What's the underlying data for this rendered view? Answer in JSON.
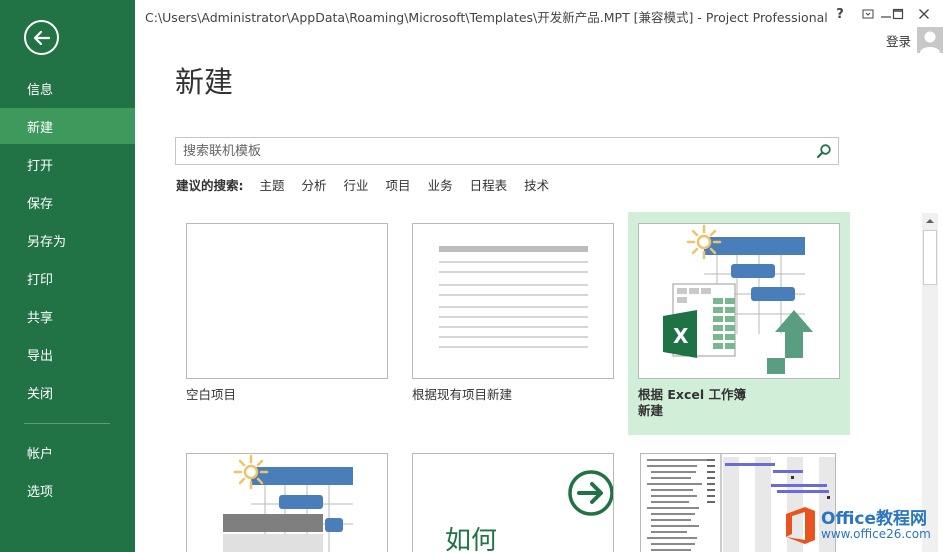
{
  "window": {
    "title": "C:\\Users\\Administrator\\AppData\\Roaming\\Microsoft\\Templates\\开发新产品.MPT [兼容模式] - Project Professional",
    "help": "?",
    "login": "登录"
  },
  "sidebar": {
    "items": [
      {
        "label": "信息"
      },
      {
        "label": "新建"
      },
      {
        "label": "打开"
      },
      {
        "label": "保存"
      },
      {
        "label": "另存为"
      },
      {
        "label": "打印"
      },
      {
        "label": "共享"
      },
      {
        "label": "导出"
      },
      {
        "label": "关闭"
      },
      {
        "label": "帐户"
      },
      {
        "label": "选项"
      }
    ],
    "active": "新建"
  },
  "main": {
    "title": "新建",
    "search": {
      "placeholder": "搜索联机模板",
      "value": ""
    },
    "suggestions": {
      "label": "建议的搜索:",
      "links": [
        "主题",
        "分析",
        "行业",
        "项目",
        "业务",
        "日程表",
        "技术"
      ]
    },
    "templates": [
      {
        "label": "空白项目"
      },
      {
        "label": "根据现有项目新建"
      },
      {
        "label_line1": "根据 Excel 工作簿",
        "label_line2": "新建"
      },
      {
        "label": ""
      },
      {
        "label": "",
        "thumb_text": "如何"
      },
      {
        "label": ""
      }
    ]
  },
  "watermark": {
    "line1": "Office教程网",
    "line2": "www.office26.com"
  },
  "colors": {
    "sidebar": "#217346",
    "sidebar_active": "#3d9a5c",
    "selected_tile": "#d1eed8",
    "accent_blue": "#4a7ebb",
    "excel_green": "#1f7244",
    "arrow_green": "#5a9e82"
  }
}
